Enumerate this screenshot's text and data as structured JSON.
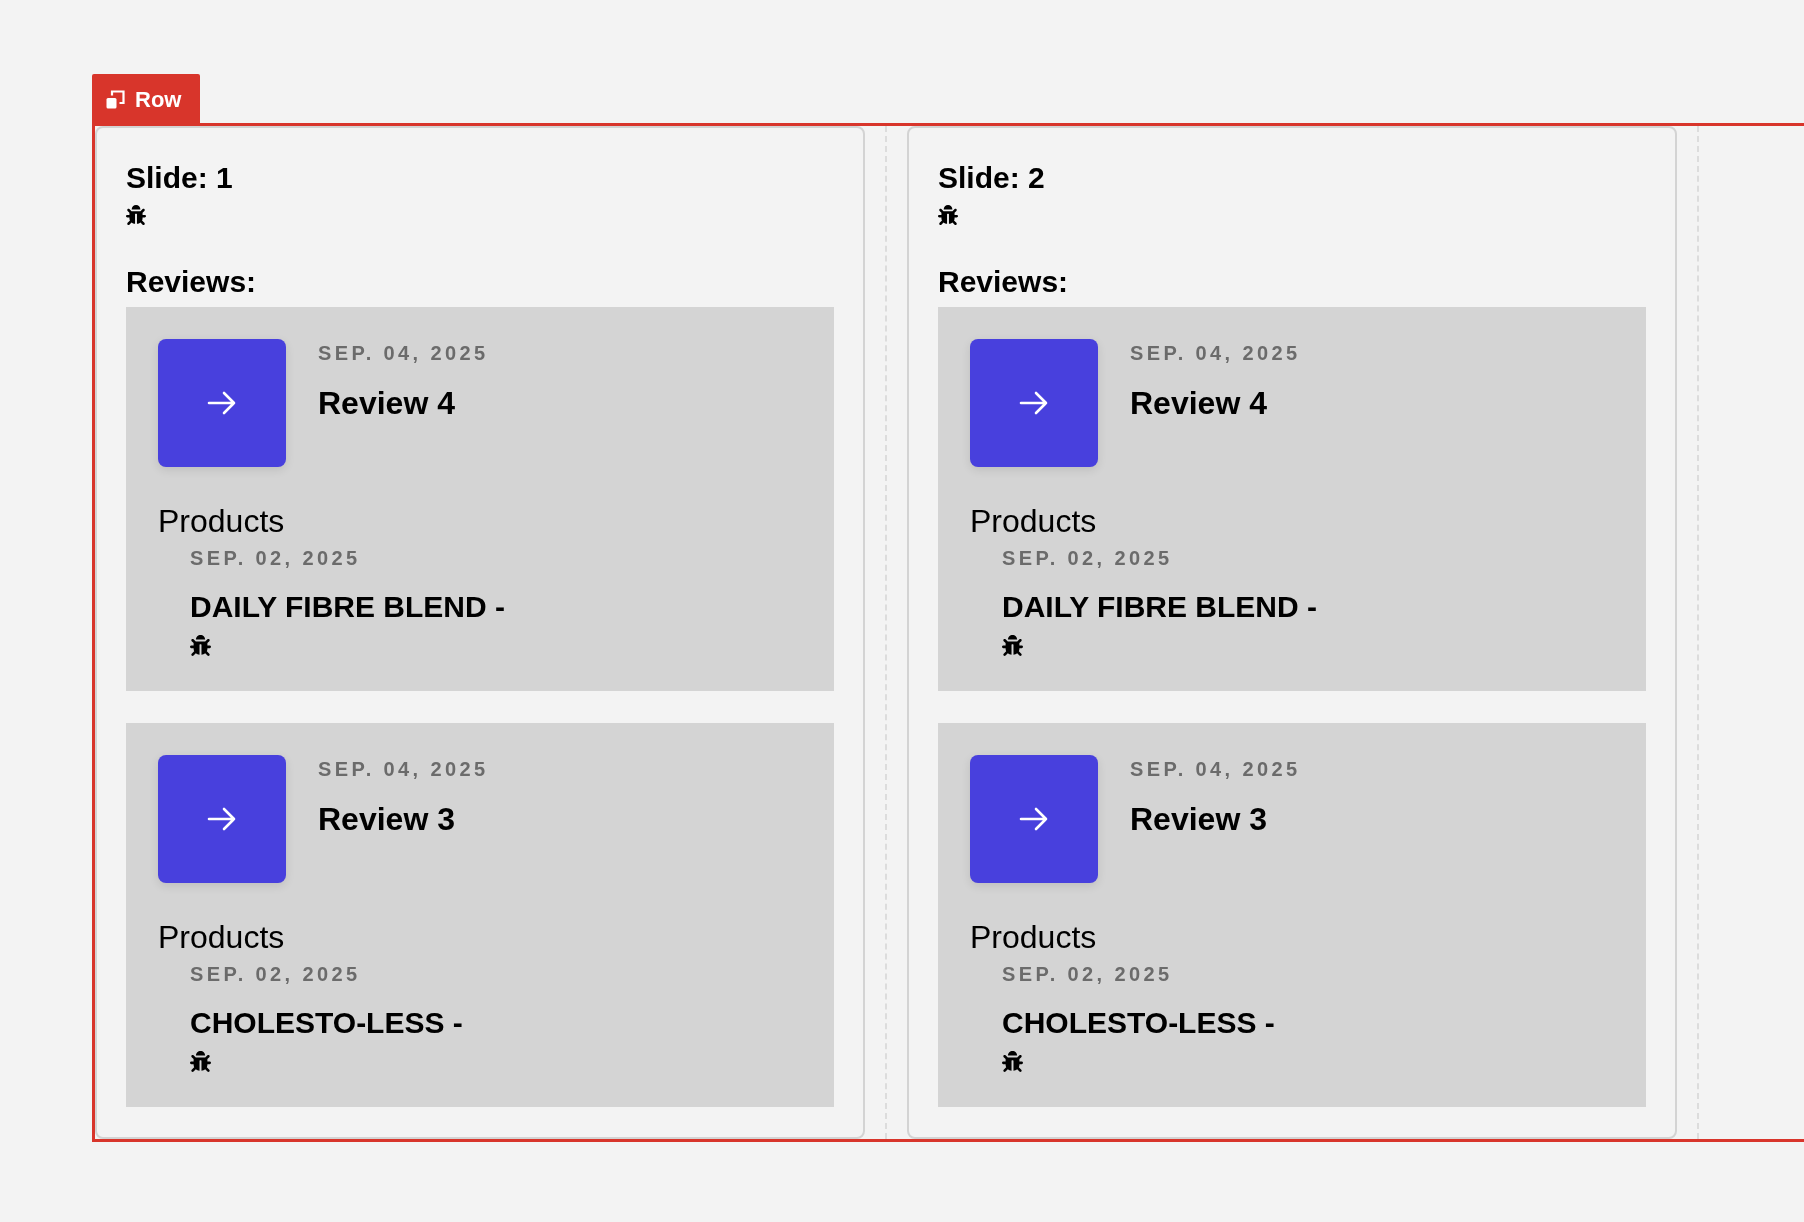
{
  "element_label": {
    "label": "Row"
  },
  "slides": [
    {
      "title": "Slide: 1",
      "reviews_heading": "Reviews:",
      "reviews": [
        {
          "date": "SEP. 04, 2025",
          "title": "Review 4",
          "products_heading": "Products",
          "products": [
            {
              "date": "SEP. 02, 2025",
              "name": "DAILY FIBRE BLEND -"
            }
          ]
        },
        {
          "date": "SEP. 04, 2025",
          "title": "Review 3",
          "products_heading": "Products",
          "products": [
            {
              "date": "SEP. 02, 2025",
              "name": "CHOLESTO-LESS -"
            }
          ]
        }
      ]
    },
    {
      "title": "Slide: 2",
      "reviews_heading": "Reviews:",
      "reviews": [
        {
          "date": "SEP. 04, 2025",
          "title": "Review 4",
          "products_heading": "Products",
          "products": [
            {
              "date": "SEP. 02, 2025",
              "name": "DAILY FIBRE BLEND -"
            }
          ]
        },
        {
          "date": "SEP. 04, 2025",
          "title": "Review 3",
          "products_heading": "Products",
          "products": [
            {
              "date": "SEP. 02, 2025",
              "name": "CHOLESTO-LESS -"
            }
          ]
        }
      ]
    }
  ]
}
